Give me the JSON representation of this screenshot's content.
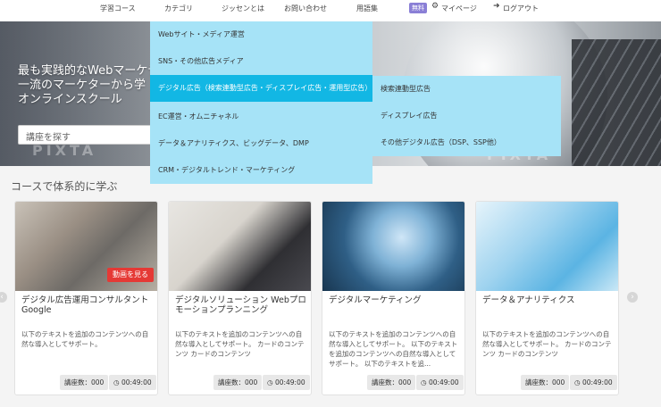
{
  "nav": {
    "items": [
      "学習コース",
      "カテゴリ",
      "ジッセンとは",
      "お問い合わせ",
      "用語集"
    ],
    "badge": "無料",
    "mypage": "マイページ",
    "login": "ログアウト"
  },
  "hero": {
    "line1": "最も実践的なWebマーケテ",
    "line2": "一流のマーケターから学",
    "line3": "オンラインスクール",
    "search_placeholder": "講座を探す",
    "watermark": "PIXTA"
  },
  "dropdown": {
    "items": [
      "Webサイト・メディア運営",
      "SNS・その他広告メディア",
      "デジタル広告（検索連動型広告・ディスプレイ広告・運用型広告）",
      "EC運営・オムニチャネル",
      "データ＆アナリティクス、ビッグデータ、DMP",
      "CRM・デジタルトレンド・マーケティング"
    ],
    "submenu": [
      "検索連動型広告",
      "ディスプレイ広告",
      "その他デジタル広告（DSP、SSP他）"
    ]
  },
  "section": {
    "title": "コースで体系的に学ぶ"
  },
  "cards": [
    {
      "title": "デジタル広告運用コンサルタント Google",
      "desc": "以下のテキストを追加のコンテンツへの自然な導入としてサポート。",
      "count": "講座数：000",
      "time": "00:49:00",
      "watch": "動画を見る"
    },
    {
      "title": "デジタルソリューション Webプロモーションプランニング",
      "desc": "以下のテキストを追加のコンテンツへの自然な導入としてサポート。 カードのコンテンツ カードのコンテンツ",
      "count": "講座数：000",
      "time": "00:49:00"
    },
    {
      "title": "デジタルマーケティング",
      "desc": "以下のテキストを追加のコンテンツへの自然な導入としてサポート。 以下のテキストを追加のコンテンツへの自然な導入としてサポート。 以下のテキストを追...",
      "count": "講座数：000",
      "time": "00:49:00"
    },
    {
      "title": "データ＆アナリティクス",
      "desc": "以下のテキストを追加のコンテンツへの自然な導入としてサポート。 カードのコンテンツ カードのコンテンツ",
      "count": "講座数：000",
      "time": "00:49:00"
    }
  ],
  "colors": {
    "dropdown": "#a6e3f7",
    "active": "#12b7e4",
    "badge": "#8a7fd6",
    "watch": "#e53935"
  }
}
